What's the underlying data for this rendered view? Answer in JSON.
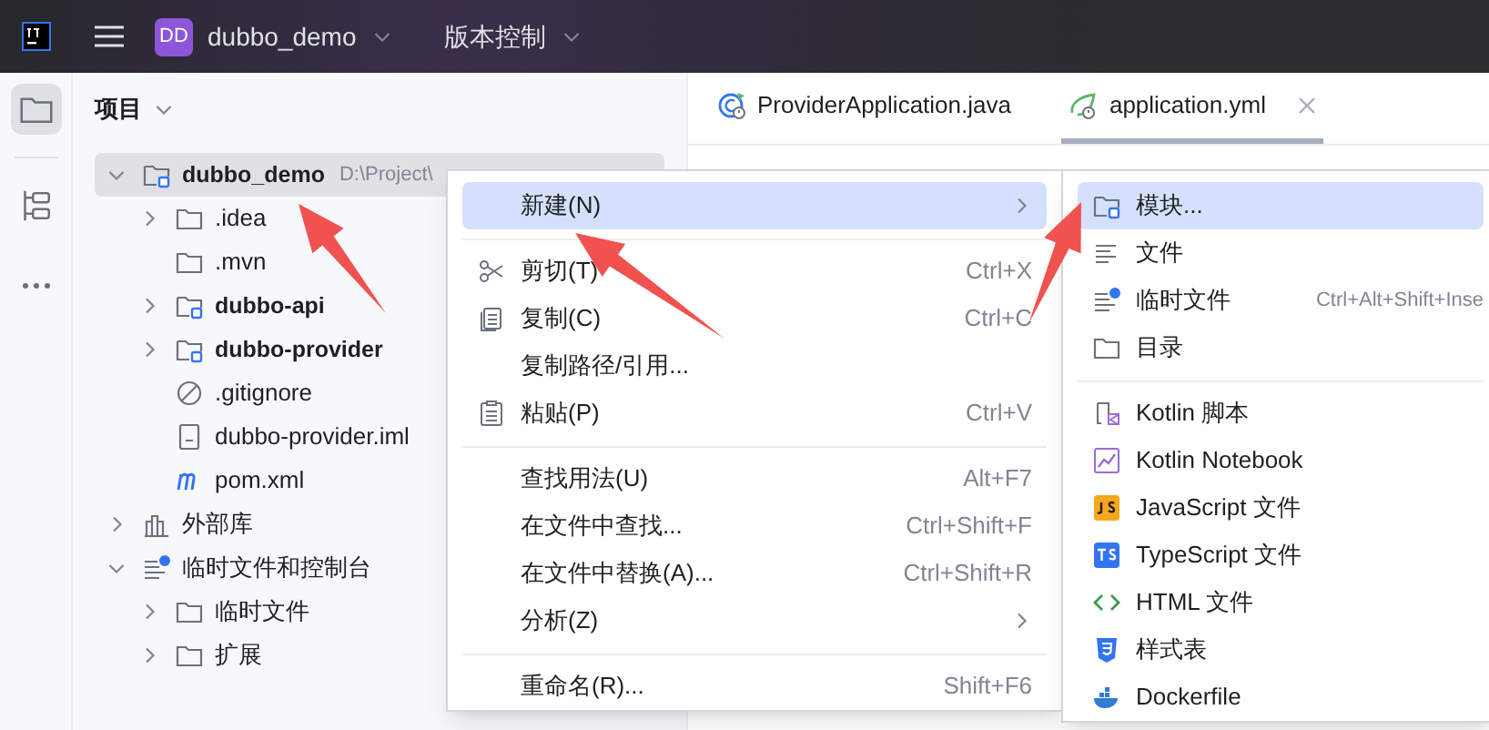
{
  "title_bar": {
    "project_badge": "DD",
    "project_name": "dubbo_demo",
    "vcs_menu": "版本控制"
  },
  "tool_strip": [
    {
      "kind": "project",
      "selected": true
    },
    {
      "kind": "structure",
      "selected": false
    },
    {
      "kind": "more",
      "selected": false
    }
  ],
  "project_panel": {
    "title": "项目",
    "tree": [
      {
        "label": "dubbo_demo",
        "hint": "D:\\Project\\",
        "kind": "module",
        "bold": true,
        "expanded": true,
        "selected": true,
        "children": [
          {
            "label": ".idea",
            "kind": "folder",
            "bold": false,
            "expanded": false,
            "selected": false
          },
          {
            "label": ".mvn",
            "kind": "folder",
            "bold": false,
            "selected": false
          },
          {
            "label": "dubbo-api",
            "kind": "module",
            "bold": true,
            "expanded": false,
            "selected": false
          },
          {
            "label": "dubbo-provider",
            "kind": "module",
            "bold": true,
            "expanded": false,
            "selected": false
          },
          {
            "label": ".gitignore",
            "kind": "ignore",
            "bold": false,
            "selected": false
          },
          {
            "label": "dubbo-provider.iml",
            "kind": "iml",
            "bold": false,
            "selected": false
          },
          {
            "label": "pom.xml",
            "kind": "maven",
            "bold": false,
            "selected": false
          }
        ]
      },
      {
        "label": "外部库",
        "kind": "library",
        "bold": false,
        "expanded": false,
        "selected": false
      },
      {
        "label": "临时文件和控制台",
        "kind": "scratch",
        "bold": false,
        "expanded": true,
        "selected": false,
        "children": [
          {
            "label": "临时文件",
            "kind": "folder",
            "bold": false,
            "expanded": false,
            "selected": false
          },
          {
            "label": "扩展",
            "kind": "folder",
            "bold": false,
            "expanded": false,
            "selected": false
          }
        ]
      }
    ]
  },
  "editor_tabs": [
    {
      "label": "ProviderApplication.java",
      "kind": "java",
      "selected": false,
      "closable": false
    },
    {
      "label": "application.yml",
      "kind": "spring",
      "selected": true,
      "closable": true
    }
  ],
  "context_menu": [
    {
      "kind": "plain",
      "label": "新建(N)",
      "submenu": true,
      "selected": true
    },
    {
      "kind": "separator"
    },
    {
      "kind": "cut",
      "label": "剪切(T)",
      "shortcut": "Ctrl+X",
      "submenu": false,
      "selected": false
    },
    {
      "kind": "copy",
      "label": "复制(C)",
      "shortcut": "Ctrl+C",
      "submenu": false,
      "selected": false
    },
    {
      "kind": "plain",
      "label": "复制路径/引用...",
      "submenu": false,
      "selected": false
    },
    {
      "kind": "paste",
      "label": "粘贴(P)",
      "shortcut": "Ctrl+V",
      "submenu": false,
      "selected": false
    },
    {
      "kind": "separator"
    },
    {
      "kind": "plain",
      "label": "查找用法(U)",
      "shortcut": "Alt+F7",
      "submenu": false,
      "selected": false
    },
    {
      "kind": "plain",
      "label": "在文件中查找...",
      "shortcut": "Ctrl+Shift+F",
      "submenu": false,
      "selected": false
    },
    {
      "kind": "plain",
      "label": "在文件中替换(A)...",
      "shortcut": "Ctrl+Shift+R",
      "submenu": false,
      "selected": false
    },
    {
      "kind": "plain",
      "label": "分析(Z)",
      "submenu": true,
      "selected": false
    },
    {
      "kind": "separator"
    },
    {
      "kind": "plain",
      "label": "重命名(R)...",
      "shortcut": "Shift+F6",
      "submenu": false,
      "selected": false
    }
  ],
  "new_submenu": [
    {
      "kind": "module",
      "label": "模块...",
      "selected": true
    },
    {
      "kind": "file",
      "label": "文件",
      "selected": false
    },
    {
      "kind": "scratch",
      "label": "临时文件",
      "shortcut": "Ctrl+Alt+Shift+Inse",
      "selected": false
    },
    {
      "kind": "folder",
      "label": "目录",
      "selected": false
    },
    {
      "kind": "separator"
    },
    {
      "kind": "kotlin_script",
      "label": "Kotlin 脚本",
      "selected": false
    },
    {
      "kind": "notebook",
      "label": "Kotlin Notebook",
      "selected": false
    },
    {
      "kind": "js",
      "label": "JavaScript 文件",
      "selected": false
    },
    {
      "kind": "ts",
      "label": "TypeScript 文件",
      "selected": false
    },
    {
      "kind": "html",
      "label": "HTML 文件",
      "selected": false
    },
    {
      "kind": "css",
      "label": "样式表",
      "selected": false
    },
    {
      "kind": "docker",
      "label": "Dockerfile",
      "selected": false
    }
  ]
}
